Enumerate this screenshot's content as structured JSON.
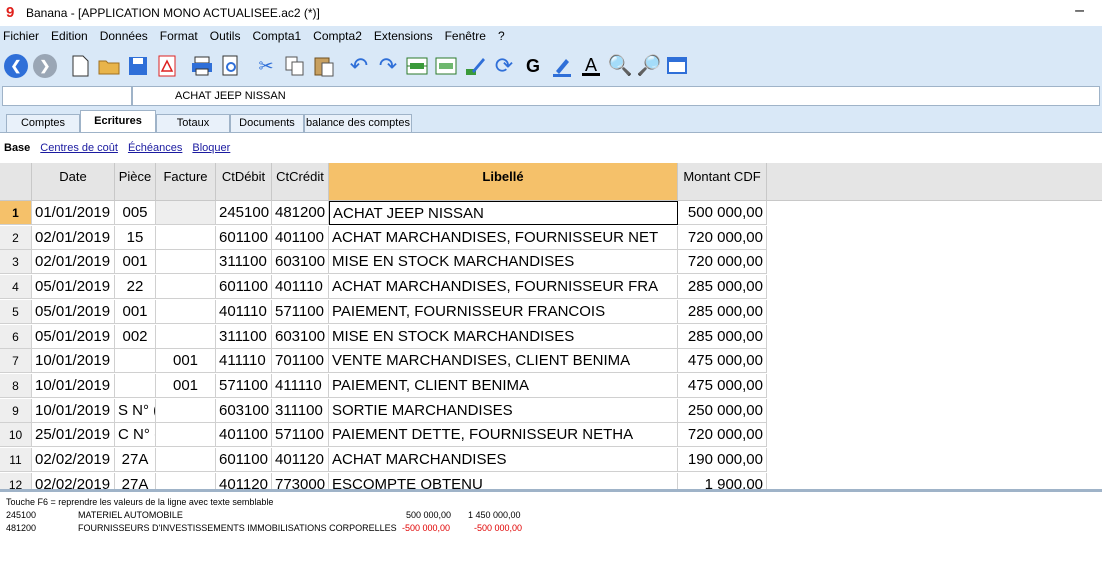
{
  "window": {
    "title": "Banana - [APPLICATION MONO ACTUALISEE.ac2 (*)]",
    "minimize": "–"
  },
  "menu": [
    "Fichier",
    "Edition",
    "Données",
    "Format",
    "Outils",
    "Compta1",
    "Compta2",
    "Extensions",
    "Fenêtre",
    "?"
  ],
  "toolbar": {
    "icons": [
      "back-icon",
      "forward-icon",
      "new-file-icon",
      "open-folder-icon",
      "save-icon",
      "pdf-icon",
      "print-icon",
      "print-preview-icon",
      "cut-icon",
      "copy-icon",
      "paste-icon",
      "undo-icon",
      "redo-icon",
      "insert-row-icon",
      "delete-row-icon",
      "edit-icon",
      "refresh-icon",
      "bold-icon",
      "highlight-icon",
      "font-color-icon",
      "find-icon",
      "find-next-icon",
      "window-icon"
    ],
    "bold_label": "G",
    "font_color_label": "A"
  },
  "formula": {
    "cell_ref": "",
    "cell_value": "ACHAT JEEP NISSAN"
  },
  "tabs": [
    "Comptes",
    "Ecritures",
    "Totaux",
    "Documents",
    "balance des comptes"
  ],
  "views": [
    "Base",
    "Centres de coût",
    "Échéances",
    "Bloquer"
  ],
  "columns": [
    "Date",
    "Pièce",
    "Facture",
    "CtDébit",
    "CtCrédit",
    "Libellé",
    "Montant CDF"
  ],
  "rows": [
    {
      "n": "1",
      "date": "01/01/2019",
      "piece": "005",
      "facture": "",
      "debit": "245100",
      "credit": "481200",
      "libelle": "ACHAT JEEP NISSAN",
      "montant": "500 000,00"
    },
    {
      "n": "2",
      "date": "02/01/2019",
      "piece": "15",
      "facture": "",
      "debit": "601100",
      "credit": "401100",
      "libelle": "ACHAT MARCHANDISES, FOURNISSEUR NET",
      "montant": "720 000,00"
    },
    {
      "n": "3",
      "date": "02/01/2019",
      "piece": "001",
      "facture": "",
      "debit": "311100",
      "credit": "603100",
      "libelle": "MISE EN STOCK MARCHANDISES",
      "montant": "720 000,00"
    },
    {
      "n": "4",
      "date": "05/01/2019",
      "piece": "22",
      "facture": "",
      "debit": "601100",
      "credit": "401110",
      "libelle": "ACHAT MARCHANDISES, FOURNISSEUR FRA",
      "montant": "285 000,00"
    },
    {
      "n": "5",
      "date": "05/01/2019",
      "piece": "001",
      "facture": "",
      "debit": "401110",
      "credit": "571100",
      "libelle": "PAIEMENT, FOURNISSEUR FRANCOIS",
      "montant": "285 000,00"
    },
    {
      "n": "6",
      "date": "05/01/2019",
      "piece": "002",
      "facture": "",
      "debit": "311100",
      "credit": "603100",
      "libelle": "MISE EN STOCK MARCHANDISES",
      "montant": "285 000,00"
    },
    {
      "n": "7",
      "date": "10/01/2019",
      "piece": "",
      "facture": "001",
      "debit": "411110",
      "credit": "701100",
      "libelle": "VENTE MARCHANDISES, CLIENT BENIMA",
      "montant": "475 000,00"
    },
    {
      "n": "8",
      "date": "10/01/2019",
      "piece": "",
      "facture": "001",
      "debit": "571100",
      "credit": "411110",
      "libelle": "PAIEMENT, CLIENT BENIMA",
      "montant": "475 000,00"
    },
    {
      "n": "9",
      "date": "10/01/2019",
      "piece": "S N° (",
      "facture": "",
      "debit": "603100",
      "credit": "311100",
      "libelle": "SORTIE MARCHANDISES",
      "montant": "250 000,00"
    },
    {
      "n": "10",
      "date": "25/01/2019",
      "piece": "C N° (",
      "facture": "",
      "debit": "401100",
      "credit": "571100",
      "libelle": "PAIEMENT  DETTE, FOURNISSEUR NETHA",
      "montant": "720 000,00"
    },
    {
      "n": "11",
      "date": "02/02/2019",
      "piece": "27A",
      "facture": "",
      "debit": "601100",
      "credit": "401120",
      "libelle": "ACHAT MARCHANDISES",
      "montant": "190 000,00"
    },
    {
      "n": "12",
      "date": "02/02/2019",
      "piece": "27A",
      "facture": "",
      "debit": "401120",
      "credit": "773000",
      "libelle": "ESCOMPTE OBTENU",
      "montant": "1 900,00"
    }
  ],
  "info": {
    "hint": "Touche F6 = reprendre les valeurs de la ligne avec texte semblable",
    "lines": [
      {
        "account": "245100",
        "desc": "MATERIEL AUTOMOBILE",
        "v1": "500 000,00",
        "v2": "1 450 000,00",
        "negative": false
      },
      {
        "account": "481200",
        "desc": "FOURNISSEURS D'INVESTISSEMENTS IMMOBILISATIONS CORPORELLES",
        "v1": "-500 000,00",
        "v2": "-500 000,00",
        "negative": true
      }
    ]
  },
  "colors": {
    "accent": "#f5c16a",
    "chrome": "#d9e8f7",
    "negative": "#e00000"
  }
}
